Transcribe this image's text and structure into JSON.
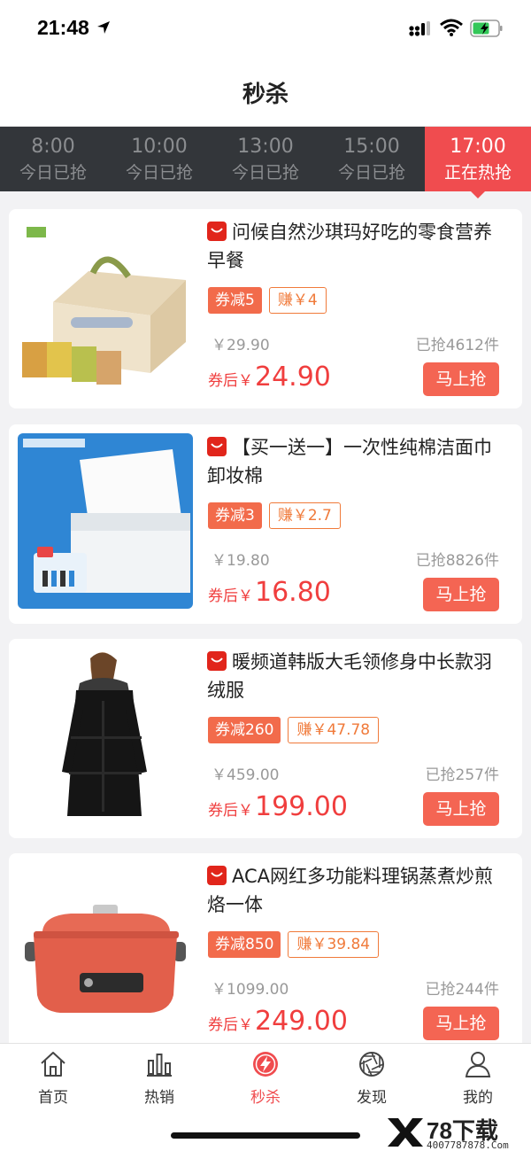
{
  "status_bar": {
    "time": "21:48"
  },
  "header": {
    "title": "秒杀"
  },
  "time_tabs": [
    {
      "time": "8:00",
      "status": "今日已抢",
      "active": false
    },
    {
      "time": "10:00",
      "status": "今日已抢",
      "active": false
    },
    {
      "time": "13:00",
      "status": "今日已抢",
      "active": false
    },
    {
      "time": "15:00",
      "status": "今日已抢",
      "active": false
    },
    {
      "time": "17:00",
      "status": "正在热抢",
      "active": true
    }
  ],
  "products": [
    {
      "title": "问候自然沙琪玛好吃的零食营养早餐",
      "coupon": "券减5",
      "earn": "赚￥4",
      "orig_price": "￥29.90",
      "sold": "已抢4612件",
      "after_label": "券后￥",
      "after_price": "24.90",
      "buy_label": "马上抢"
    },
    {
      "title": "【买一送一】一次性纯棉洁面巾卸妆棉",
      "coupon": "券减3",
      "earn": "赚￥2.7",
      "orig_price": "￥19.80",
      "sold": "已抢8826件",
      "after_label": "券后￥",
      "after_price": "16.80",
      "buy_label": "马上抢"
    },
    {
      "title": "暖频道韩版大毛领修身中长款羽绒服",
      "coupon": "券减260",
      "earn": "赚￥47.78",
      "orig_price": "￥459.00",
      "sold": "已抢257件",
      "after_label": "券后￥",
      "after_price": "199.00",
      "buy_label": "马上抢"
    },
    {
      "title": "ACA网红多功能料理锅蒸煮炒煎烙一体",
      "coupon": "券减850",
      "earn": "赚￥39.84",
      "orig_price": "￥1099.00",
      "sold": "已抢244件",
      "after_label": "券后￥",
      "after_price": "249.00",
      "buy_label": "马上抢"
    }
  ],
  "tab_bar": [
    {
      "label": "首页",
      "icon": "home-icon",
      "active": false
    },
    {
      "label": "热销",
      "icon": "bar-chart-icon",
      "active": false
    },
    {
      "label": "秒杀",
      "icon": "lightning-icon",
      "active": true
    },
    {
      "label": "发现",
      "icon": "aperture-icon",
      "active": false
    },
    {
      "label": "我的",
      "icon": "user-icon",
      "active": false
    }
  ],
  "watermark": {
    "text": "78下载",
    "sub": "4007787878.Com"
  },
  "colors": {
    "accent": "#f04c4f",
    "coupon": "#f26b4b",
    "earn": "#f07a3a",
    "price": "#f03e3e",
    "tab_bg": "#33363a"
  }
}
